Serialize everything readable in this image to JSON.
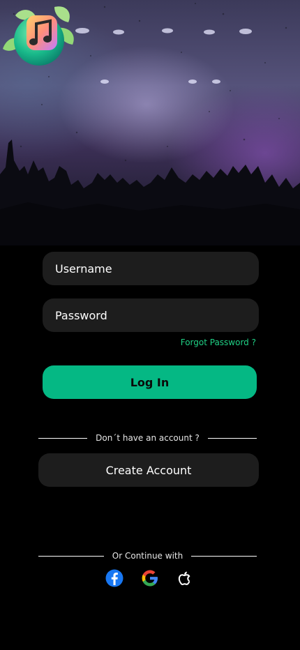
{
  "hero": {
    "logo_alt": "music app logo"
  },
  "form": {
    "username_placeholder": "Username",
    "password_placeholder": "Password",
    "forgot_password": "Forgot Password ?",
    "login_button": "Log In"
  },
  "signup": {
    "divider_text": "Don´t have an account ?",
    "create_account_button": "Create Account"
  },
  "social": {
    "divider_text": "Or Continue with",
    "providers": [
      "facebook",
      "google",
      "apple"
    ]
  },
  "colors": {
    "accent": "#05b884",
    "link": "#1fd085",
    "field_bg": "#1d1d1d",
    "background": "#000000"
  }
}
